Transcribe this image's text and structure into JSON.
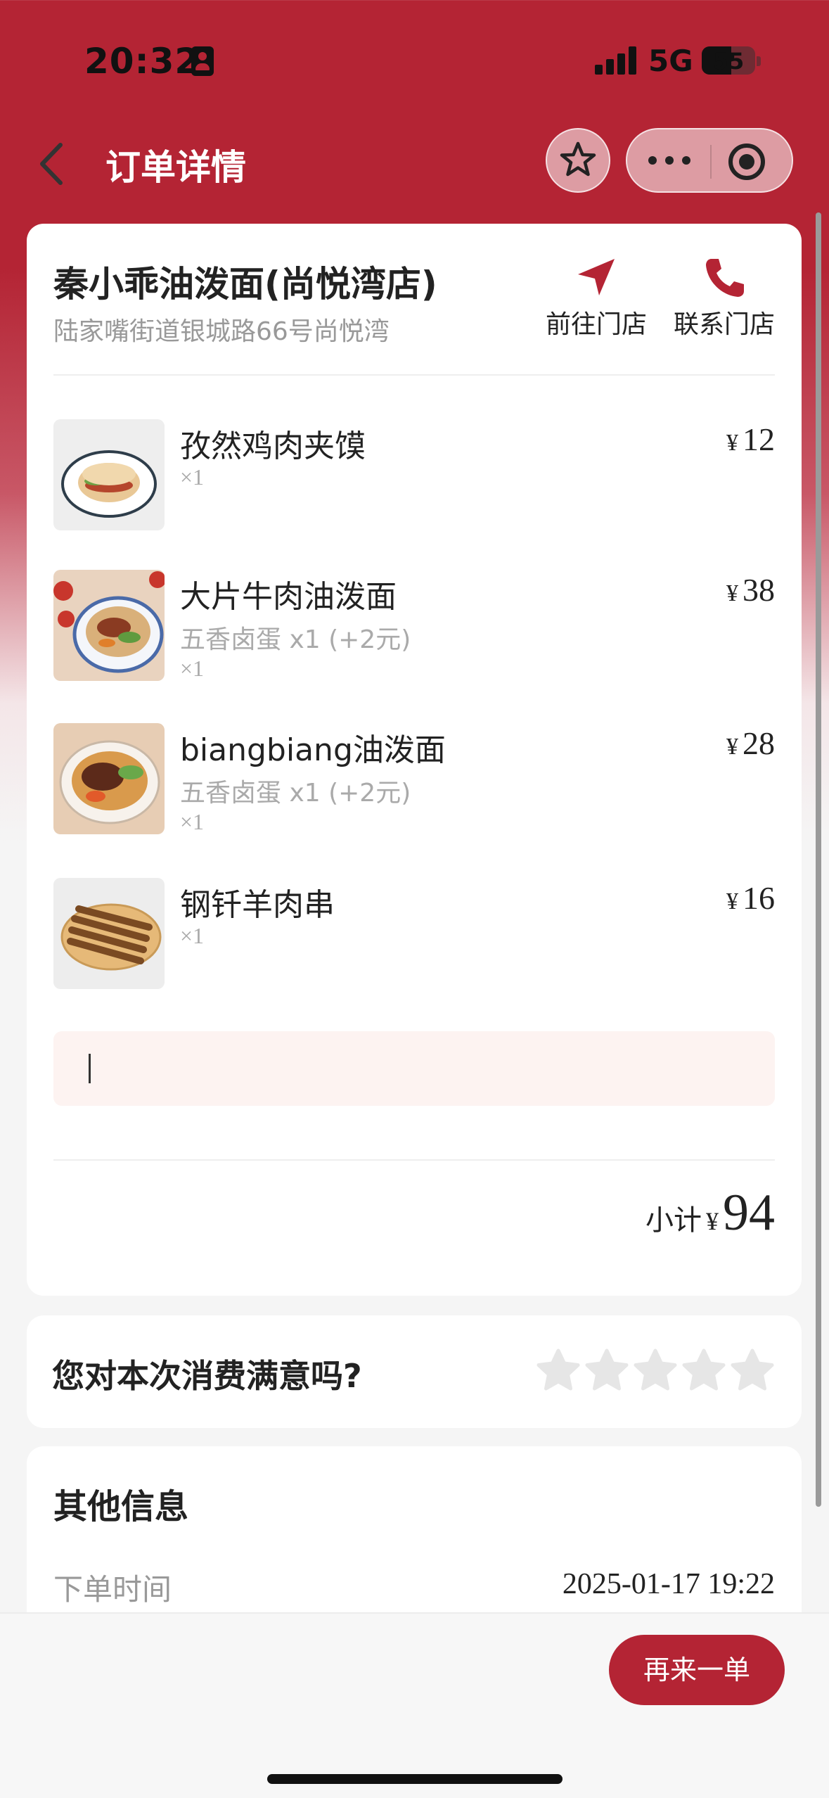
{
  "status_bar": {
    "time": "20:32",
    "network": "5G",
    "battery": "55"
  },
  "nav": {
    "title": "订单详情",
    "icons": [
      "back-chevron-icon",
      "star-icon",
      "more-dots-icon",
      "target-icon"
    ]
  },
  "store": {
    "name": "秦小乖油泼面(尚悦湾店)",
    "address": "陆家嘴街道银城路66号尚悦湾",
    "actions": [
      {
        "label": "前往门店",
        "icon": "navigation-arrow-icon"
      },
      {
        "label": "联系门店",
        "icon": "phone-icon"
      }
    ]
  },
  "order": {
    "currency": "¥",
    "items": [
      {
        "name": "孜然鸡肉夹馍",
        "spec": "",
        "qty": "×1",
        "price": "12"
      },
      {
        "name": "大片牛肉油泼面",
        "spec": "五香卤蛋 x1 (+2元)",
        "qty": "×1",
        "price": "38"
      },
      {
        "name": "biangbiang油泼面",
        "spec": "五香卤蛋 x1 (+2元)",
        "qty": "×1",
        "price": "28"
      },
      {
        "name": "钢钎羊肉串",
        "spec": "",
        "qty": "×1",
        "price": "16"
      }
    ],
    "subtotal_label": "小计",
    "subtotal": "94"
  },
  "rating": {
    "question": "您对本次消费满意吗?",
    "stars": 5,
    "selected": 0
  },
  "info": {
    "title": "其他信息",
    "order_time_label": "下单时间",
    "order_time": "2025-01-17 19:22"
  },
  "footer": {
    "reorder_label": "再来一单"
  },
  "colors": {
    "brand": "#b42434",
    "note_bg": "#fdf3f1",
    "star_empty": "#e6e6e6"
  }
}
